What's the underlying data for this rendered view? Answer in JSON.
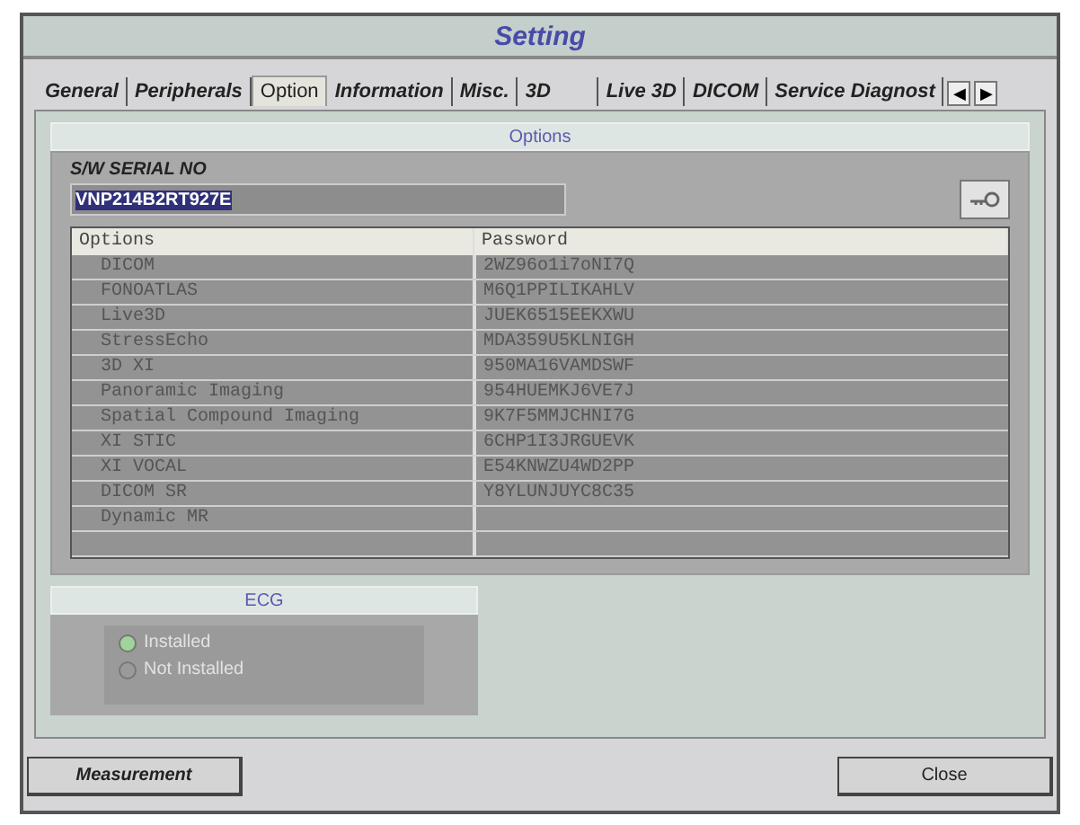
{
  "window": {
    "title": "Setting"
  },
  "tabs": [
    {
      "label": "General",
      "selected": false
    },
    {
      "label": "Peripherals",
      "selected": false
    },
    {
      "label": "Option",
      "selected": true
    },
    {
      "label": "Information",
      "selected": false
    },
    {
      "label": "Misc.",
      "selected": false
    },
    {
      "label": "3D",
      "selected": false
    },
    {
      "label": "Live 3D",
      "selected": false
    },
    {
      "label": "DICOM",
      "selected": false
    },
    {
      "label": "Service Diagnost",
      "selected": false
    }
  ],
  "tab_scroll": [
    "◀",
    "▶"
  ],
  "options_group": {
    "title": "Options",
    "serial_label": "S/W SERIAL NO",
    "serial_value": "VNP214B2RT927E",
    "table": {
      "columns": [
        "Options",
        "Password"
      ],
      "rows": [
        {
          "option": "DICOM",
          "password": "2WZ96o1i7oNI7Q"
        },
        {
          "option": "FONOATLAS",
          "password": "M6Q1PPILIKAHLV"
        },
        {
          "option": "Live3D",
          "password": "JUEK6515EEKXWU"
        },
        {
          "option": "StressEcho",
          "password": "MDA359U5KLNIGH"
        },
        {
          "option": "3D XI",
          "password": "950MA16VAMDSWF"
        },
        {
          "option": "Panoramic Imaging",
          "password": "954HUEMKJ6VE7J"
        },
        {
          "option": "Spatial Compound Imaging",
          "password": "9K7F5MMJCHNI7G"
        },
        {
          "option": "XI STIC",
          "password": "6CHP1I3JRGUEVK"
        },
        {
          "option": "XI VOCAL",
          "password": "E54KNWZU4WD2PP"
        },
        {
          "option": "DICOM SR",
          "password": "Y8YLUNJUYC8C35"
        },
        {
          "option": "Dynamic MR"
        }
      ]
    }
  },
  "ecg_group": {
    "title": "ECG",
    "radios": [
      {
        "label": "Installed",
        "selected": true
      },
      {
        "label": "Not Installed",
        "selected": false
      }
    ]
  },
  "buttons": [
    {
      "label": "Measurement"
    },
    {
      "label": "Close"
    }
  ]
}
